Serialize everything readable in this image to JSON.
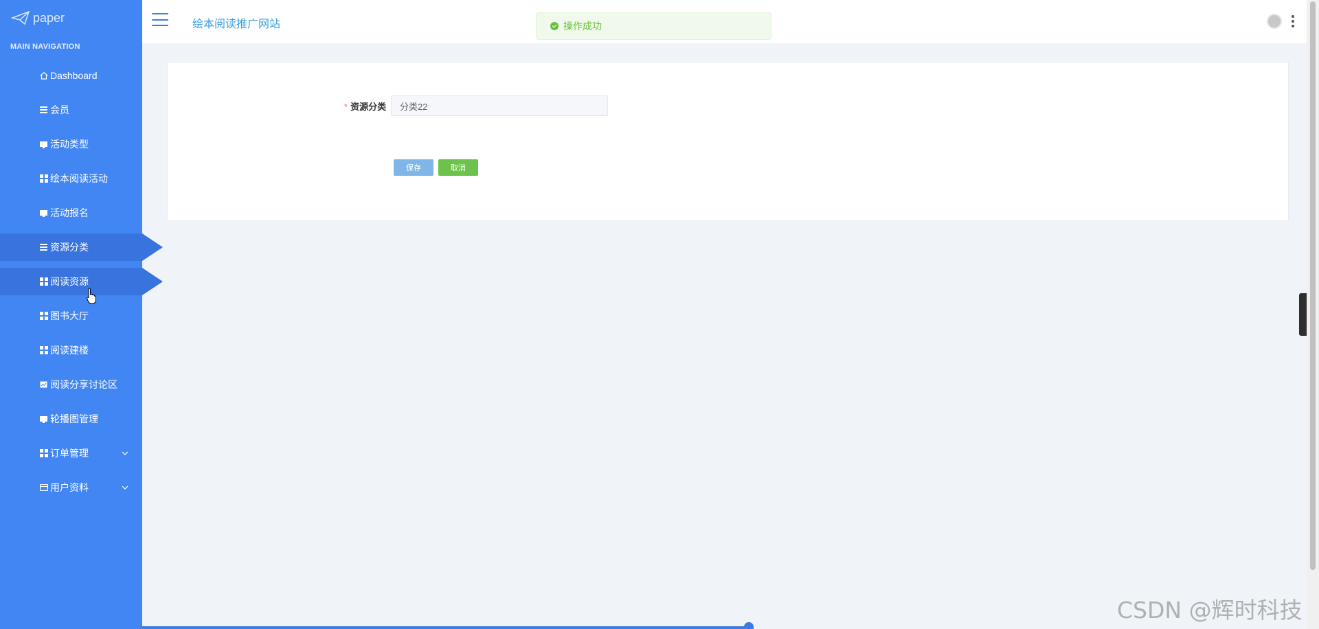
{
  "sidebar": {
    "logo_text": "paper",
    "nav_title": "MAIN NAVIGATION",
    "items": [
      {
        "label": "Dashboard",
        "icon": "home-icon"
      },
      {
        "label": "会员",
        "icon": "list-icon"
      },
      {
        "label": "活动类型",
        "icon": "monitor-icon"
      },
      {
        "label": "绘本阅读活动",
        "icon": "grid-icon"
      },
      {
        "label": "活动报名",
        "icon": "comment-icon"
      },
      {
        "label": "资源分类",
        "icon": "list-icon",
        "active": true
      },
      {
        "label": "阅读资源",
        "icon": "grid-icon",
        "active": true
      },
      {
        "label": "图书大厅",
        "icon": "grid-icon"
      },
      {
        "label": "阅读建楼",
        "icon": "grid-icon"
      },
      {
        "label": "阅读分享讨论区",
        "icon": "image-icon"
      },
      {
        "label": "轮播图管理",
        "icon": "monitor-icon"
      },
      {
        "label": "订单管理",
        "icon": "grid-icon",
        "has_children": true
      },
      {
        "label": "用户资料",
        "icon": "card-icon",
        "has_children": true
      }
    ]
  },
  "header": {
    "site_title": "绘本阅读推广网站"
  },
  "toast": {
    "message": "操作成功",
    "color": "#67c23a"
  },
  "form": {
    "category_label": "资源分类",
    "required_mark": "*",
    "category_value": "分类22",
    "save_label": "保存",
    "cancel_label": "取消"
  },
  "watermark": "CSDN @辉时科技",
  "colors": {
    "sidebar_bg": "#4286f4",
    "accent": "#3b7be6",
    "save_button": "#7fb5e7",
    "cancel_button": "#6cc24a"
  }
}
